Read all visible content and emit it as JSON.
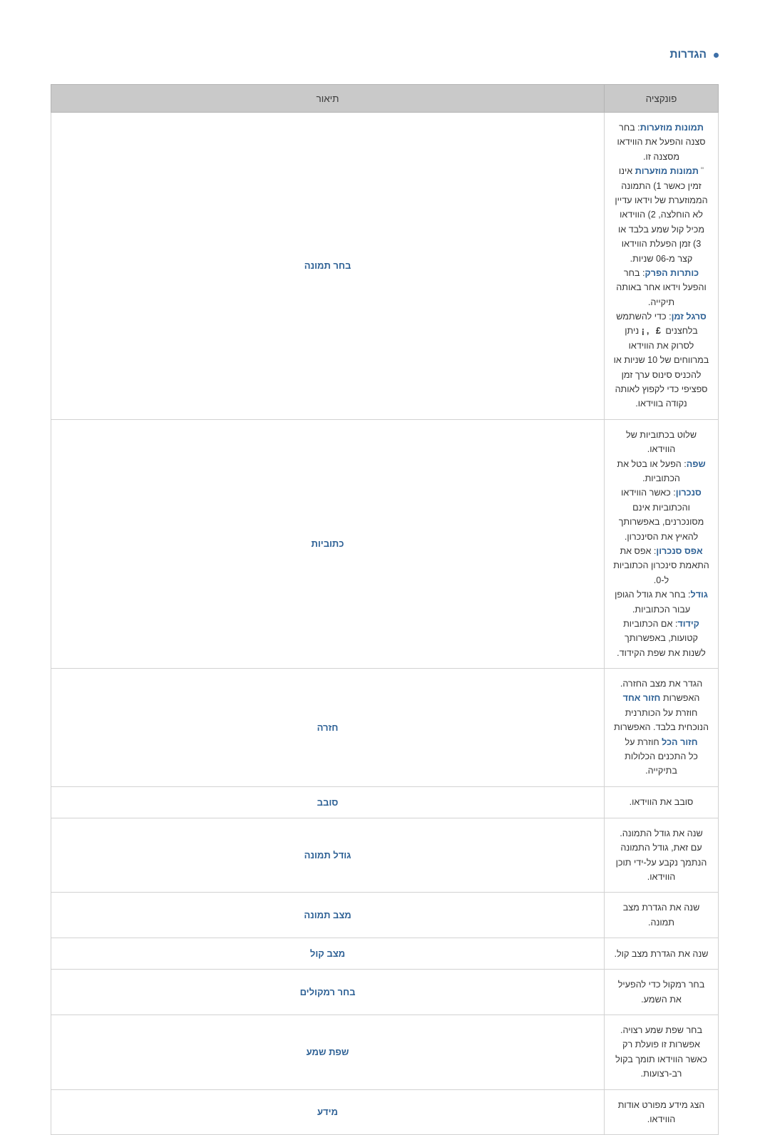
{
  "section": {
    "bullet": "•",
    "title": "הגדרות"
  },
  "table": {
    "headers": {
      "feature": "פונקציה",
      "description": "תיאור"
    },
    "rows": [
      {
        "feature": "בחר תמונה",
        "lines": [
          {
            "parts": [
              {
                "text": "תמונות מוזערות",
                "kw": true
              },
              {
                "text": ": בחר סצנה והפעל את הווידאו מסצנה זו.",
                "kw": false
              }
            ]
          },
          {
            "quote": true,
            "parts": [
              {
                "text": "תמונות מוזערות",
                "kw": true
              },
              {
                "text": " אינו זמין כאשר 1) התמונה הממוזערת של וידאו עדיין לא הוחלצה, 2) הווידאו מכיל קול שמע בלבד או 3) זמן הפעלת הווידאו קצר מ-06 שניות.",
                "kw": false
              }
            ]
          },
          {
            "parts": [
              {
                "text": "כותרות הפרק",
                "kw": true
              },
              {
                "text": ": בחר והפעל וידאו אחר באותה תיקייה.",
                "kw": false
              }
            ]
          },
          {
            "parts": [
              {
                "text": "סרגל זמן",
                "kw": true
              },
              {
                "text": ": כדי להשתמש בלחצנים ",
                "kw": false
              },
              {
                "text": "£ ,¡",
                "currency": true
              },
              {
                "text": " ניתן לסרוק את הווידאו במרווחים של 10 שניות או להכניס סינוס ערך זמן ספציפי כדי לקפוץ לאותה נקודה בווידאו.",
                "kw": false
              }
            ]
          }
        ]
      },
      {
        "feature": "כתוביות",
        "lines": [
          {
            "parts": [
              {
                "text": "שלוט בכתוביות של הווידאו.",
                "kw": false
              }
            ]
          },
          {
            "parts": [
              {
                "text": "שפה",
                "kw": true
              },
              {
                "text": ": הפעל או בטל את הכתוביות.",
                "kw": false
              }
            ]
          },
          {
            "parts": [
              {
                "text": "סנכרון",
                "kw": true
              },
              {
                "text": ": כאשר הווידאו והכתוביות אינם מסונכרנים, באפשרותך להאיץ את הסינכרון.",
                "kw": false
              }
            ]
          },
          {
            "parts": [
              {
                "text": "אפס סנכרון",
                "kw": true
              },
              {
                "text": ": אפס את התאמת סינכרון הכתוביות ל-0.",
                "kw": false
              }
            ]
          },
          {
            "parts": [
              {
                "text": "גודל",
                "kw": true
              },
              {
                "text": ": בחר את גודל הגופן עבור הכתוביות.",
                "kw": false
              }
            ]
          },
          {
            "parts": [
              {
                "text": "קידוד",
                "kw": true
              },
              {
                "text": ": אם הכתוביות קטועות, באפשרותך לשנות את שפת הקידוד.",
                "kw": false
              }
            ]
          }
        ]
      },
      {
        "feature": "חזרה",
        "lines": [
          {
            "parts": [
              {
                "text": "הגדר את מצב החזרה. האפשרות ",
                "kw": false
              },
              {
                "text": "חזור אחד",
                "kw": true
              },
              {
                "text": " חוזרת על הכותרנית הנוכחית בלבד. האפשרות ",
                "kw": false
              },
              {
                "text": "חזור הכל",
                "kw": true
              },
              {
                "text": " חוזרת על",
                "kw": false
              }
            ]
          },
          {
            "parts": [
              {
                "text": "כל התכנים הכלולות בתיקייה.",
                "kw": false
              }
            ]
          }
        ]
      },
      {
        "feature": "סובב",
        "lines": [
          {
            "parts": [
              {
                "text": "סובב את הווידאו.",
                "kw": false
              }
            ]
          }
        ]
      },
      {
        "feature": "גודל תמונה",
        "lines": [
          {
            "parts": [
              {
                "text": "שנה את גודל התמונה. עם זאת, גודל התמונה הנתמך נקבע על-ידי תוכן הווידאו.",
                "kw": false
              }
            ]
          }
        ]
      },
      {
        "feature": "מצב תמונה",
        "lines": [
          {
            "parts": [
              {
                "text": "שנה את הגדרת מצב תמונה.",
                "kw": false
              }
            ]
          }
        ]
      },
      {
        "feature": "מצב קול",
        "lines": [
          {
            "parts": [
              {
                "text": "שנה את הגדרת מצב קול.",
                "kw": false
              }
            ]
          }
        ]
      },
      {
        "feature": "בחר רמקולים",
        "lines": [
          {
            "parts": [
              {
                "text": "בחר רמקול כדי להפעיל את השמע.",
                "kw": false
              }
            ]
          }
        ]
      },
      {
        "feature": "שפת שמע",
        "lines": [
          {
            "parts": [
              {
                "text": "בחר שפת שמע רצויה. אפשרות זו פועלת רק כאשר הווידאו תומך בקול רב-רצועות.",
                "kw": false
              }
            ]
          }
        ]
      },
      {
        "feature": "מידע",
        "lines": [
          {
            "parts": [
              {
                "text": "הצג מידע מפורט אודות הווידאו.",
                "kw": false
              }
            ]
          }
        ]
      }
    ]
  },
  "colors": {
    "accent": "#2f6296",
    "header_bg": "#c9c9c9",
    "border": "#d2d2d2",
    "text": "#333333"
  }
}
